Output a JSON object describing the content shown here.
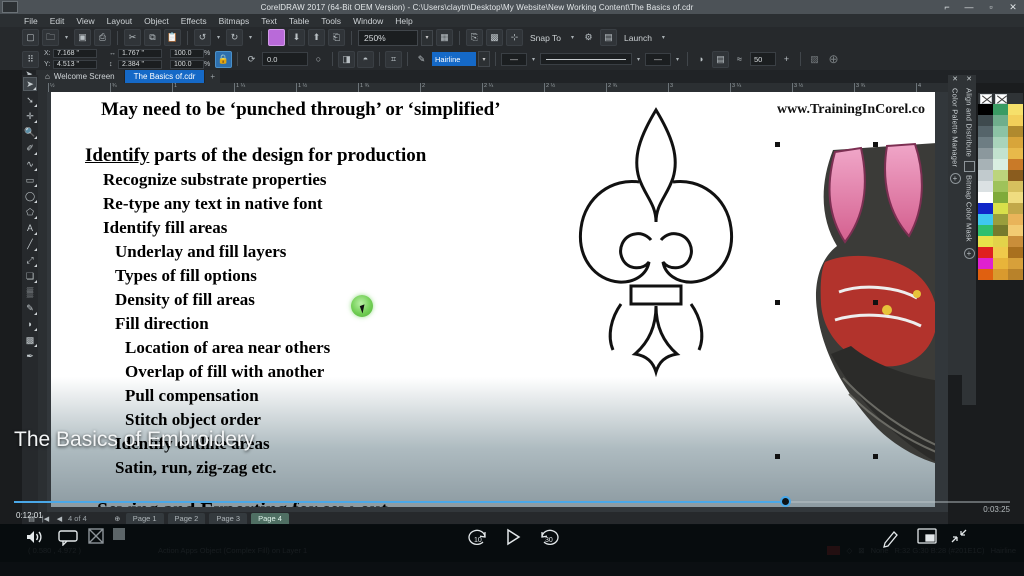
{
  "window": {
    "title": "CorelDRAW 2017 (64-Bit OEM Version) - C:\\Users\\claytn\\Desktop\\My Website\\New Working Content\\The Basics of.cdr",
    "buttons": {
      "restore": "⌐",
      "minimize": "—",
      "maximize": "▫",
      "close": "✕"
    }
  },
  "menu": [
    "File",
    "Edit",
    "View",
    "Layout",
    "Object",
    "Effects",
    "Bitmaps",
    "Text",
    "Table",
    "Tools",
    "Window",
    "Help"
  ],
  "standard_toolbar": {
    "icons": [
      "new-document-icon",
      "open-document-icon",
      "save-icon",
      "print-icon",
      "cut-icon",
      "copy-icon",
      "paste-icon",
      "undo-icon",
      "redo-icon",
      "import-icon",
      "export-icon",
      "export-pdf-icon",
      "publish-pdf-icon"
    ],
    "zoom_level": "250%",
    "zoom_fit_icon": "zoom-to-fit-icon",
    "options": [
      "full-screen-preview-icon",
      "view-grid-icon",
      "guidelines-icon"
    ],
    "snap_to_label": "Snap To",
    "settings_icon": "gear-icon",
    "launch_label": "Launch"
  },
  "property_bar": {
    "object_position_icon": "object-position-icon",
    "x_label": "X:",
    "x_value": "7.168 \"",
    "y_label": "Y:",
    "y_value": "4.513 \"",
    "width_value": "1.767 \"",
    "height_value": "2.384 \"",
    "scale_h": "100.0",
    "scale_v": "100.0",
    "lock_ratio_icon": "lock-ratio-icon",
    "rotation_value": "0.0",
    "mirror_icons": [
      "mirror-horizontal-icon",
      "mirror-vertical-icon"
    ],
    "wrap_text_icon": "wrap-text-icon",
    "outline_width": "Hairline",
    "outline_style_preview": "solid-line",
    "arrow_start": "none-arrow",
    "arrow_end": "none-arrow",
    "edit_shape_icon": "convert-to-curves-icon",
    "text_properties_icon": "text-properties-icon",
    "blend_icon": "blend-icon",
    "blend_steps": "50",
    "blend_plus": "+",
    "add_icon": "add-object-icon"
  },
  "document_tabs": [
    {
      "label": "Welcome Screen",
      "active": false,
      "icon": "home-icon"
    },
    {
      "label": "The Basics of.cdr",
      "active": true
    },
    {
      "label": "+",
      "active": false
    }
  ],
  "toolbox": [
    "pick-tool-icon",
    "shape-tool-icon",
    "crop-tool-icon",
    "zoom-tool-icon",
    "freehand-tool-icon",
    "smart-fill-icon",
    "rectangle-tool-icon",
    "ellipse-tool-icon",
    "polygon-tool-icon",
    "text-tool-icon",
    "parallel-dimension-icon",
    "connector-tool-icon",
    "drop-shadow-icon",
    "transparency-tool-icon",
    "color-eyedropper-icon",
    "interactive-fill-icon",
    "mesh-fill-icon",
    "outline-pen-icon"
  ],
  "ruler": {
    "horizontal_ticks": [
      "½",
      "¾",
      "1",
      "1 ¼",
      "1 ½",
      "1 ¾",
      "2",
      "2 ¼",
      "2 ½",
      "2 ¾",
      "3",
      "3 ¼",
      "3 ½",
      "3 ¾",
      "4"
    ]
  },
  "slide": {
    "website": "www.TrainingInCorel.co",
    "lines": [
      {
        "text": "May need to be ‘punched through’ or ‘simplified’",
        "level": "l0"
      },
      {
        "text": "Identify parts of the design for production",
        "level": "h",
        "underline_word": "Identify"
      },
      {
        "text": "Recognize substrate properties",
        "level": "l1"
      },
      {
        "text": "Re-type any text in native font",
        "level": "l1"
      },
      {
        "text": "Identify fill areas",
        "level": "l1"
      },
      {
        "text": "Underlay and fill layers",
        "level": "l2"
      },
      {
        "text": "Types of fill options",
        "level": "l2"
      },
      {
        "text": "Density of fill areas",
        "level": "l2"
      },
      {
        "text": "Fill direction",
        "level": "l2"
      },
      {
        "text": "Location of area near others",
        "level": "l3"
      },
      {
        "text": "Overlap of fill with another",
        "level": "l3"
      },
      {
        "text": "Pull compensation",
        "level": "l3"
      },
      {
        "text": "Stitch object order",
        "level": "l3"
      },
      {
        "text": "Identify outline areas",
        "level": "l2"
      },
      {
        "text": "Satin, run, zig-zag etc.",
        "level": "l2"
      },
      {
        "text": "Sewing and Exporting for sew-out",
        "level": "last"
      }
    ],
    "artwork": [
      "fleur-de-lis-outline",
      "embroidered-faces-bitmap"
    ]
  },
  "dockers": [
    {
      "label": "Color Palette Manager",
      "close": "✕"
    },
    {
      "label": "Align and Distribute",
      "close": "✕"
    },
    {
      "label": "Bitmap Color Mask",
      "close": ""
    }
  ],
  "page_bar": {
    "nav": [
      "first-page-icon",
      "previous-page-icon"
    ],
    "page_indicator": "4 of 4",
    "add_page_icon": "add-page-icon",
    "tabs": [
      {
        "label": "Page 1",
        "active": false
      },
      {
        "label": "Page 2",
        "active": false
      },
      {
        "label": "Page 3",
        "active": false
      },
      {
        "label": "Page 4",
        "active": true
      }
    ]
  },
  "status_bar": {
    "coordinates": "( 0.580 , 4.972 )",
    "object_info": "Action Apps Object (Complex Fill) on Layer 1",
    "fill_label": "None",
    "color_readout": "R:32 G:30 B:28 (#201E1C)",
    "outline_readout": "Hairline"
  },
  "video_player": {
    "title": "The Basics of Embroidery",
    "elapsed": "0:12:01",
    "remaining": "0:03:25",
    "progress_percent": 77,
    "controls": {
      "volume_icon": "speaker-icon",
      "captions_icon": "closed-captions-icon",
      "airplay_icon": "airplay-icon",
      "stop_icon": "stop-icon",
      "rewind_label": "10",
      "play_icon": "play-icon",
      "forward_label": "30",
      "markup_icon": "pencil-markup-icon",
      "pip_icon": "picture-in-picture-icon",
      "exit_fullscreen_icon": "exit-fullscreen-icon"
    }
  }
}
